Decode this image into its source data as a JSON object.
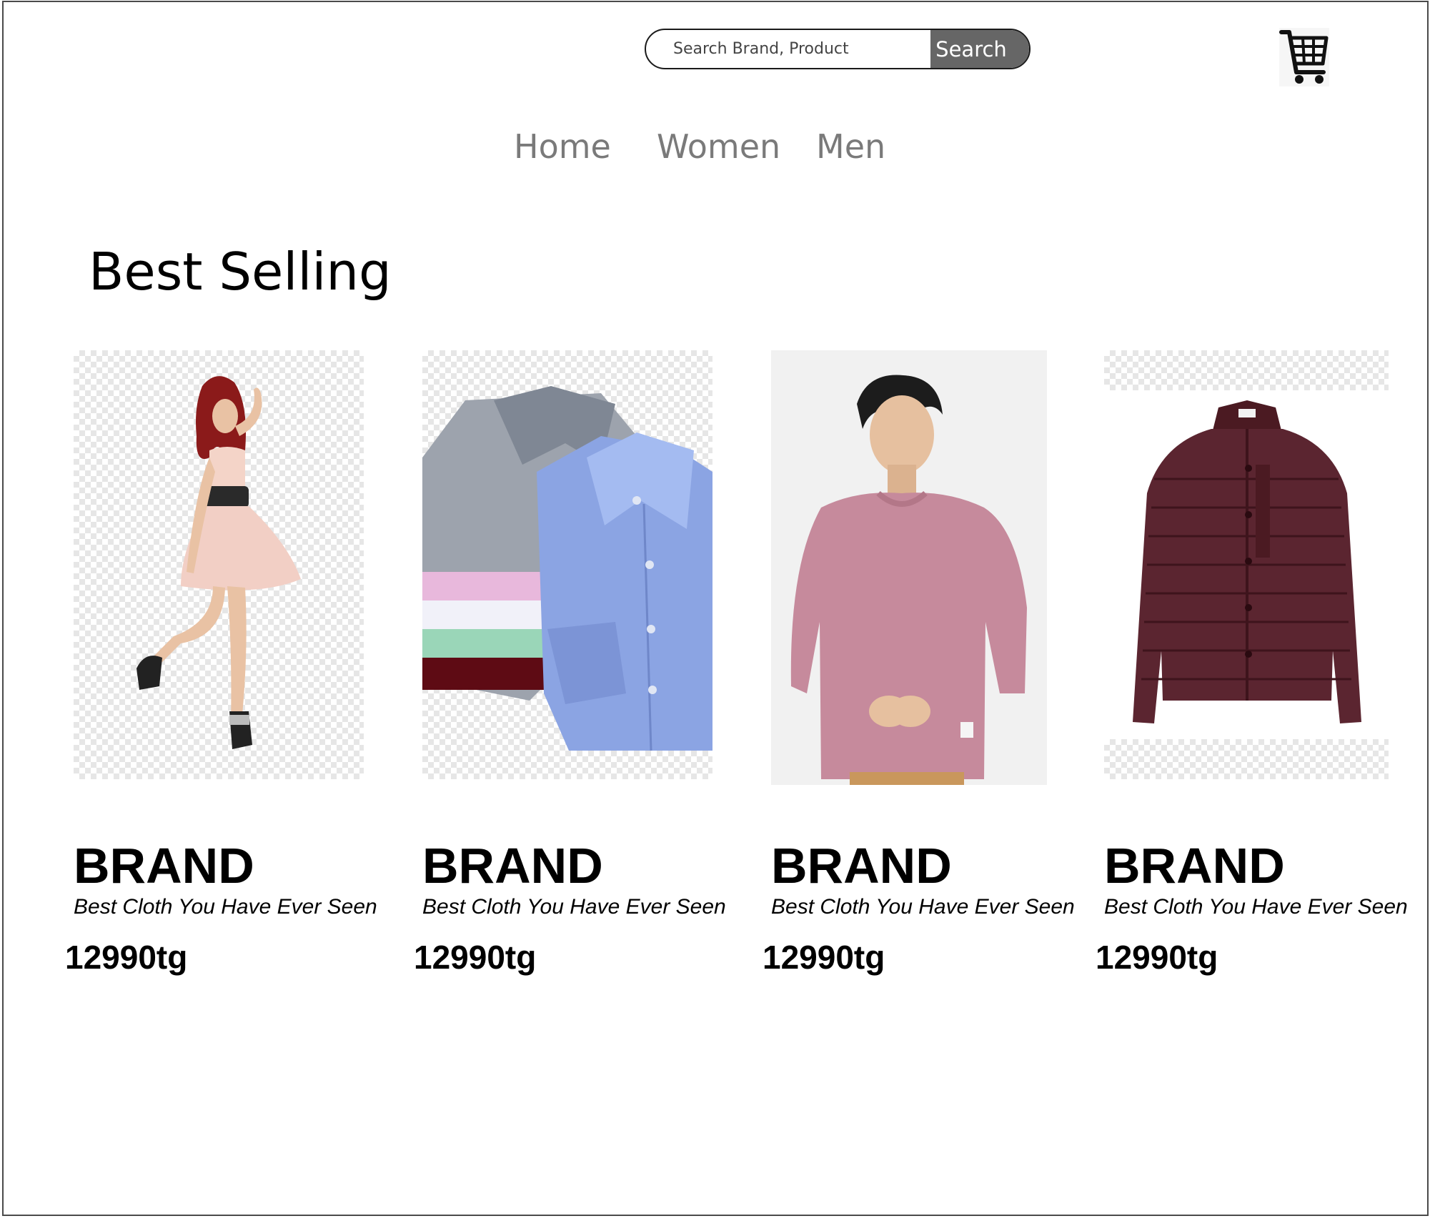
{
  "header": {
    "search": {
      "placeholder": "Search Brand, Product",
      "button_label": "Search"
    },
    "cart_icon": "shopping-cart-icon"
  },
  "nav": {
    "items": [
      "Home",
      "Women",
      "Men"
    ]
  },
  "section": {
    "title": "Best Selling"
  },
  "products": [
    {
      "brand": "BRAND",
      "tagline": "Best Cloth You Have Ever Seen",
      "price": "12990tg",
      "image": "woman-in-pink-dress"
    },
    {
      "brand": "BRAND",
      "tagline": "Best Cloth You Have Ever Seen",
      "price": "12990tg",
      "image": "folded-dress-shirts"
    },
    {
      "brand": "BRAND",
      "tagline": "Best Cloth You Have Ever Seen",
      "price": "12990tg",
      "image": "man-in-pink-sweatshirt"
    },
    {
      "brand": "BRAND",
      "tagline": "Best Cloth You Have Ever Seen",
      "price": "12990tg",
      "image": "burgundy-puffer-jacket"
    }
  ]
}
